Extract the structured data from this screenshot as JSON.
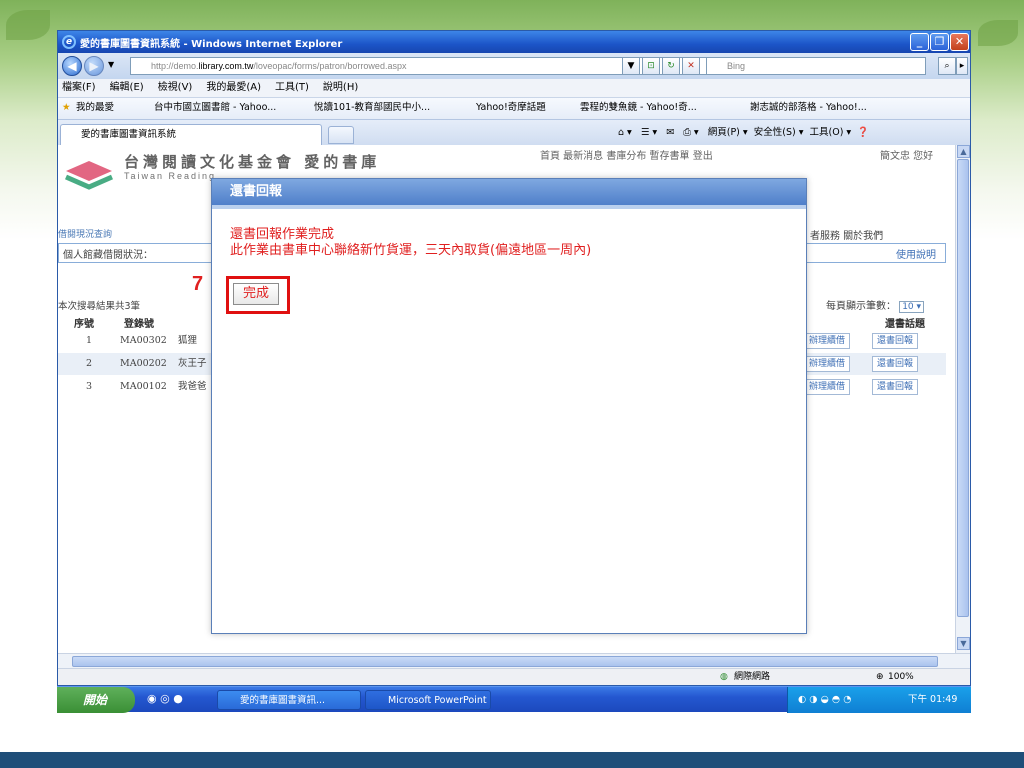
{
  "window": {
    "title": "愛的書庫圖書資訊系統 - Windows Internet Explorer",
    "address_prefix": "http://demo.",
    "address_host": "library.com.tw",
    "address_path": "/loveopac/forms/patron/borrowed.aspx",
    "search_engine": "Bing"
  },
  "menu": [
    "檔案(F)",
    "編輯(E)",
    "檢視(V)",
    "我的最愛(A)",
    "工具(T)",
    "說明(H)"
  ],
  "favorites": {
    "label": "我的最愛",
    "items": [
      "台中市國立圖書館 - Yahoo...",
      "悅讀101-教育部國民中小...",
      "Yahoo!奇摩話題",
      "雲程的雙魚鏡 - Yahoo!奇...",
      "謝志誠的部落格 - Yahoo!..."
    ]
  },
  "tab": {
    "label": "愛的書庫圖書資訊系統"
  },
  "commands": {
    "page": "網頁(P)",
    "safety": "安全性(S)",
    "tools": "工具(O)"
  },
  "site": {
    "logo_zh": "台灣閱讀文化基金會 愛的書庫",
    "logo_en": "Taiwan Reading",
    "topnav": "首頁 最新消息 書庫分布 暫存書單 登出",
    "user": "簡文忠 您好",
    "breadcrumb": "借閱現況查詢",
    "right_nav": "者服務    關於我們",
    "status_label": "個人館藏借閱狀況：",
    "help": "使用說明",
    "result_count": "本次搜尋結果共3筆",
    "per_page_label": "每頁顯示筆數：",
    "per_page_value": "10",
    "col_no": "序號",
    "col_id": "登錄號",
    "col_action": "還書話題"
  },
  "rows": [
    {
      "no": "1",
      "id": "MA00302",
      "title": "狐狸",
      "btn1": "辦理續借",
      "btn2": "還書回報"
    },
    {
      "no": "2",
      "id": "MA00202",
      "title": "灰王子",
      "btn1": "辦理續借",
      "btn2": "還書回報"
    },
    {
      "no": "3",
      "id": "MA00102",
      "title": "我爸爸",
      "btn1": "辦理續借",
      "btn2": "還書回報"
    }
  ],
  "modal": {
    "title": "還書回報",
    "line1": "還書回報作業完成",
    "line2": "此作業由書車中心聯絡新竹貨運，三天內取貨(偏遠地區一周內)",
    "step": "7",
    "done": "完成"
  },
  "status": {
    "zone": "網際網路",
    "zoom": "100%"
  },
  "taskbar": {
    "start": "開始",
    "task1": "愛的書庫圖書資訊...",
    "task2": "Microsoft PowerPoint ...",
    "clock": "下午 01:49"
  }
}
